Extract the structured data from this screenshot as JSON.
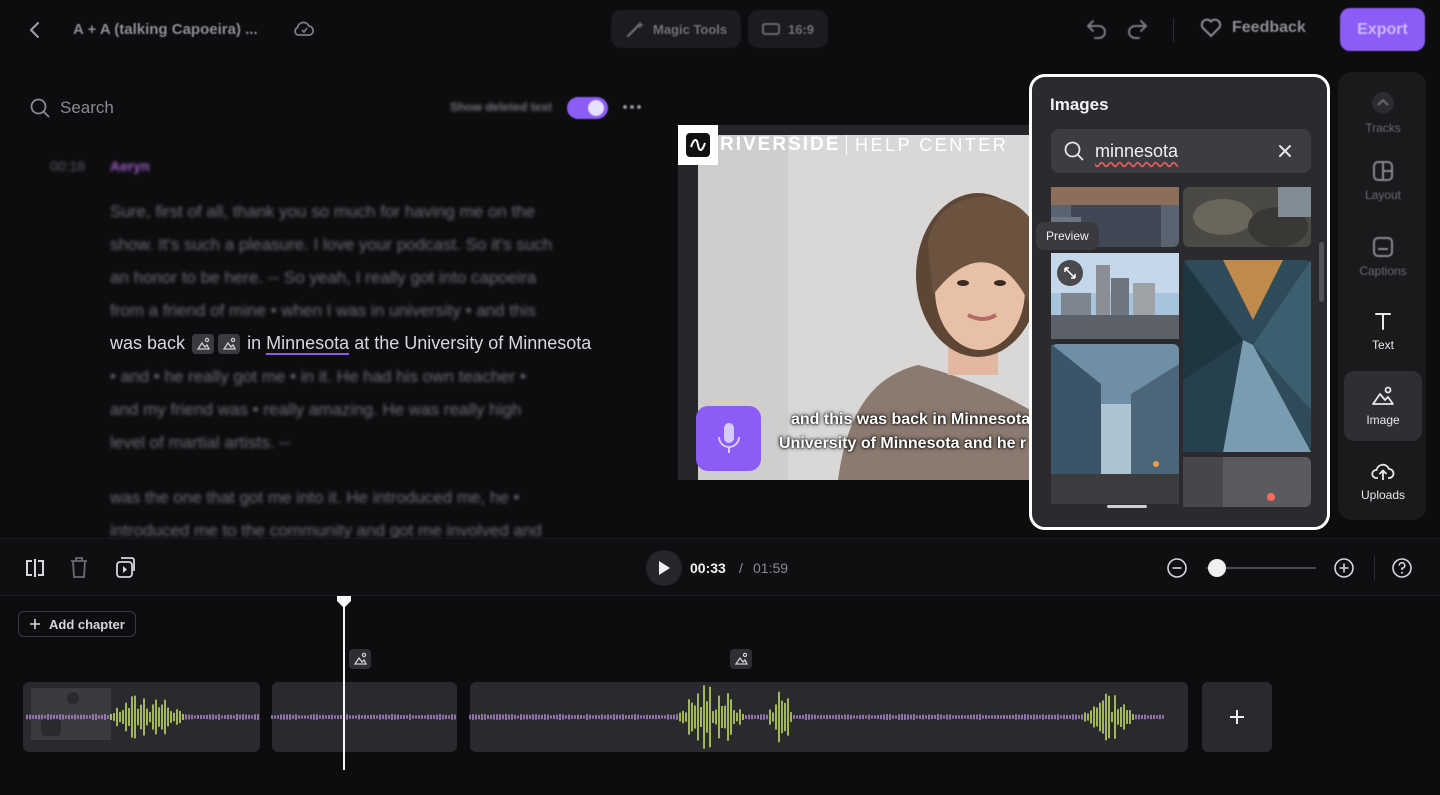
{
  "header": {
    "back_icon": "chevron-left-icon",
    "project_title": "A + A (talking Capoeira) ...",
    "cloud_icon": "cloud-sync-icon",
    "magic_tools_label": "Magic Tools",
    "aspect_label": "16:9",
    "feedback_label": "Feedback",
    "export_label": "Export"
  },
  "transcript": {
    "search_placeholder": "Search",
    "show_deleted_label": "Show deleted text",
    "show_deleted_on": true,
    "timestamp": "00:18",
    "speaker": "Aeryn",
    "lines": [
      "Sure, first of all, thank you so much for having me on the",
      "show. It's such a pleasure. I love your podcast. So it's such",
      "an honor to be here. -- So yeah, I really got into capoeira",
      "from a friend of mine • when I was in university • and this"
    ],
    "active_line": {
      "before": "was back",
      "word": "Minnesota",
      "after": "at the University of Minnesota",
      "in_word": "in"
    },
    "lines_after": [
      "• and • he really got me • in it. He had his own teacher •",
      "and my friend was • really amazing. He was really high",
      "level of martial artists. --"
    ],
    "paragraph2": [
      "was the one that got me into it. He introduced me, he •",
      "introduced me to the community and got me involved and"
    ]
  },
  "video": {
    "brand": "RIVERSIDE",
    "brand_sub": "HELP CENTER",
    "caption_line1": "and this was back in Minnesota",
    "caption_line2": "University of Minnesota and he r"
  },
  "images_panel": {
    "title": "Images",
    "search_value": "minnesota",
    "preview_tooltip": "Preview"
  },
  "right_toolbar": {
    "items": [
      {
        "label": "Tracks",
        "icon": "tracks-icon"
      },
      {
        "label": "Layout",
        "icon": "layout-icon"
      },
      {
        "label": "Captions",
        "icon": "captions-icon"
      },
      {
        "label": "Text",
        "icon": "text-icon"
      },
      {
        "label": "Image",
        "icon": "image-icon"
      },
      {
        "label": "Uploads",
        "icon": "upload-icon"
      }
    ]
  },
  "playback": {
    "current_time": "00:33",
    "separator": "/",
    "total_time": "01:59",
    "zoom_level": 0.1
  },
  "timeline": {
    "add_chapter_label": "Add chapter",
    "playhead_time": "00:33"
  },
  "colors": {
    "accent": "#8b5cf6",
    "waveform": "#c8e66b",
    "waveform_dim": "#b48bd6",
    "panel": "#2b2b2f",
    "background": "#0d0d0f"
  }
}
